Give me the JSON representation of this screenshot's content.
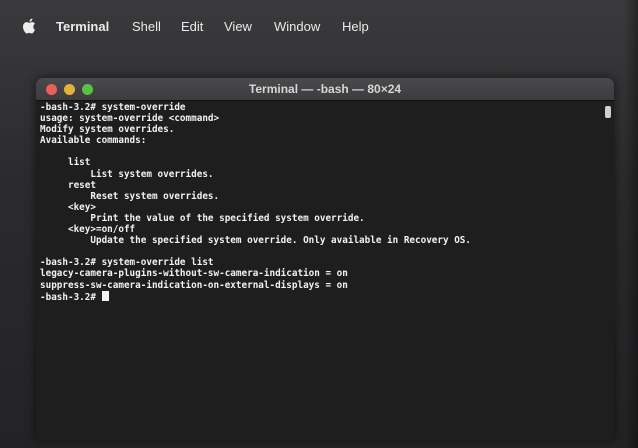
{
  "menubar": {
    "apple_icon": "apple-icon",
    "items": [
      "Terminal",
      "Shell",
      "Edit",
      "View",
      "Window",
      "Help"
    ]
  },
  "window": {
    "title": "Terminal — -bash — 80×24"
  },
  "terminal": {
    "lines": [
      "-bash-3.2# system-override",
      "usage: system-override <command>",
      "Modify system overrides.",
      "Available commands:",
      "",
      "     list",
      "         List system overrides.",
      "     reset",
      "         Reset system overrides.",
      "     <key>",
      "         Print the value of the specified system override.",
      "     <key>=on/off",
      "         Update the specified system override. Only available in Recovery OS.",
      "",
      "-bash-3.2# system-override list",
      "legacy-camera-plugins-without-sw-camera-indication = on",
      "suppress-sw-camera-indication-on-external-displays = on",
      "-bash-3.2# "
    ]
  },
  "colors": {
    "terminal_bg": "#1e1e1e",
    "terminal_fg": "#f2f2f2",
    "close": "#ec5f57",
    "minimize": "#e1b33a",
    "zoom": "#58c343"
  }
}
